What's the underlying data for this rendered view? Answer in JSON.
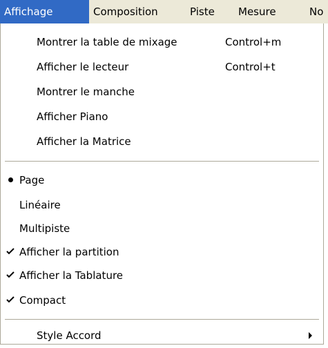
{
  "menubar": {
    "items": [
      {
        "label": "Affichage"
      },
      {
        "label": "Composition"
      },
      {
        "label": "Piste"
      },
      {
        "label": "Mesure"
      },
      {
        "label": "No"
      }
    ]
  },
  "dropdown": {
    "group1": [
      {
        "label": "Montrer la table de mixage",
        "shortcut": "Control+m"
      },
      {
        "label": "Afficher le lecteur",
        "shortcut": "Control+t"
      },
      {
        "label": "Montrer le manche"
      },
      {
        "label": "Afficher Piano"
      },
      {
        "label": "Afficher la Matrice"
      }
    ],
    "group2": [
      {
        "label": "Page",
        "mark": "bullet"
      },
      {
        "label": "Linéaire"
      },
      {
        "label": "Multipiste"
      },
      {
        "label": "Afficher la partition",
        "mark": "check"
      },
      {
        "label": "Afficher la Tablature",
        "mark": "check"
      },
      {
        "label": "Compact",
        "mark": "check"
      }
    ],
    "group3": [
      {
        "label": "Style Accord",
        "submenu": true
      }
    ]
  },
  "colors": {
    "menubar_bg": "#ece9d8",
    "highlight": "#316ac5"
  }
}
